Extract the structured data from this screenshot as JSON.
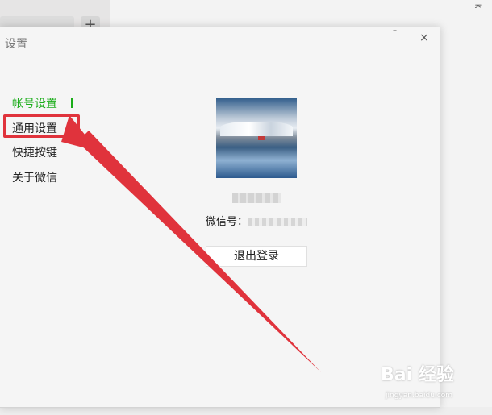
{
  "background": {
    "plus_label": "+",
    "pin_label": "ᅎ"
  },
  "dialog": {
    "title": "设置",
    "minimize_label": "ˉ",
    "close_label": "×"
  },
  "nav": {
    "items": [
      {
        "label": "帐号设置"
      },
      {
        "label": "通用设置"
      },
      {
        "label": "快捷按键"
      },
      {
        "label": "关于微信"
      }
    ],
    "active_index": 0
  },
  "profile": {
    "wechat_id_label": "微信号："
  },
  "actions": {
    "logout_label": "退出登录"
  },
  "colors": {
    "accent_green": "#1aad19",
    "annotation_red": "#e0333c"
  },
  "watermark": {
    "brand": "Bai 经验",
    "url": "jingyan.baidu.com"
  }
}
